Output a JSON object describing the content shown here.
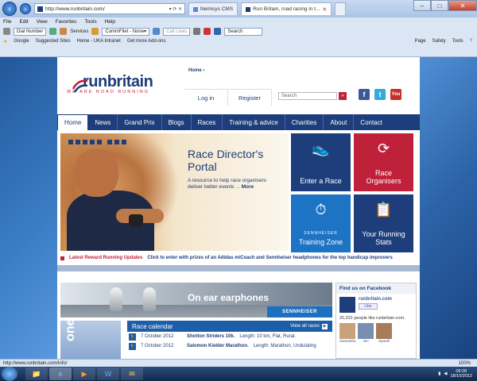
{
  "browser": {
    "url": "http://www.runbritain.com/",
    "tabs": [
      {
        "label": "Nemisys CMS"
      },
      {
        "label": "Run Britain, road racing in t..."
      }
    ],
    "menu": [
      "File",
      "Edit",
      "View",
      "Favorites",
      "Tools",
      "Help"
    ],
    "toolbar": {
      "dial_label": "Dial Number",
      "services_label": "Services",
      "commfile_value": "CommFilet - None",
      "call_label": "Call Lines",
      "search_placeholder": "Search"
    },
    "favorites": [
      "Google",
      "Suggested Sites",
      "Home - UKA Intranet",
      "Get more Add-ons"
    ],
    "command_bar": [
      "Page",
      "Safety",
      "Tools"
    ],
    "status_url": "http://www.runbritain.com/info/",
    "zoom": "100%"
  },
  "site": {
    "logo_run": "run",
    "logo_britain": "britain",
    "logo_tagline": "WE ARE ROAD RUNNING",
    "breadcrumb": "Home ›",
    "login": "Log in",
    "register": "Register",
    "search_placeholder": "Search",
    "search_go": "»",
    "nav": [
      "Home",
      "News",
      "Grand Prix",
      "Blogs",
      "Races",
      "Training & advice",
      "Charities",
      "About",
      "Contact"
    ],
    "hero": {
      "title": "Race Director's Portal",
      "description": "A resource to help race organisers deliver better events ...",
      "more": "More"
    },
    "tiles": [
      {
        "label": "Enter a Race",
        "color": "#1d3d7b"
      },
      {
        "label": "Race Organisers",
        "color": "#c0213a"
      },
      {
        "label": "Training Zone",
        "brand": "SENNHEISER",
        "color": "#1d73c4"
      },
      {
        "label": "Your Running Stats",
        "color": "#1d3d7b"
      }
    ],
    "ticker": {
      "label": "Latest Reward Running Updates",
      "text": "Click to enter with prizes of an Adidas miCoach and Sennheiser headphones for the top handicap improvers"
    },
    "banner": {
      "text": "On ear earphones",
      "brand": "SENNHEISER"
    },
    "side_image_text": "ones",
    "facebook": {
      "title": "Find us on Facebook",
      "page_name": "runbritain.com",
      "like": "Like",
      "count_text": "20,331 people like runbritain.com.",
      "faces": [
        "Samantha",
        "Jen",
        "Sparell"
      ]
    },
    "calendar": {
      "title": "Race calendar",
      "view_all": "View all races",
      "rows": [
        {
          "date": "7 October 2012",
          "event": "Shotton Striders 10k.",
          "details": "Length: 10 km, Flat, Rural."
        },
        {
          "date": "7 October 2012",
          "event": "Salomon Kielder Marathon.",
          "details": "Length: Marathon, Undulating"
        }
      ]
    }
  },
  "taskbar": {
    "time": "09:28",
    "date": "18/10/2012"
  }
}
